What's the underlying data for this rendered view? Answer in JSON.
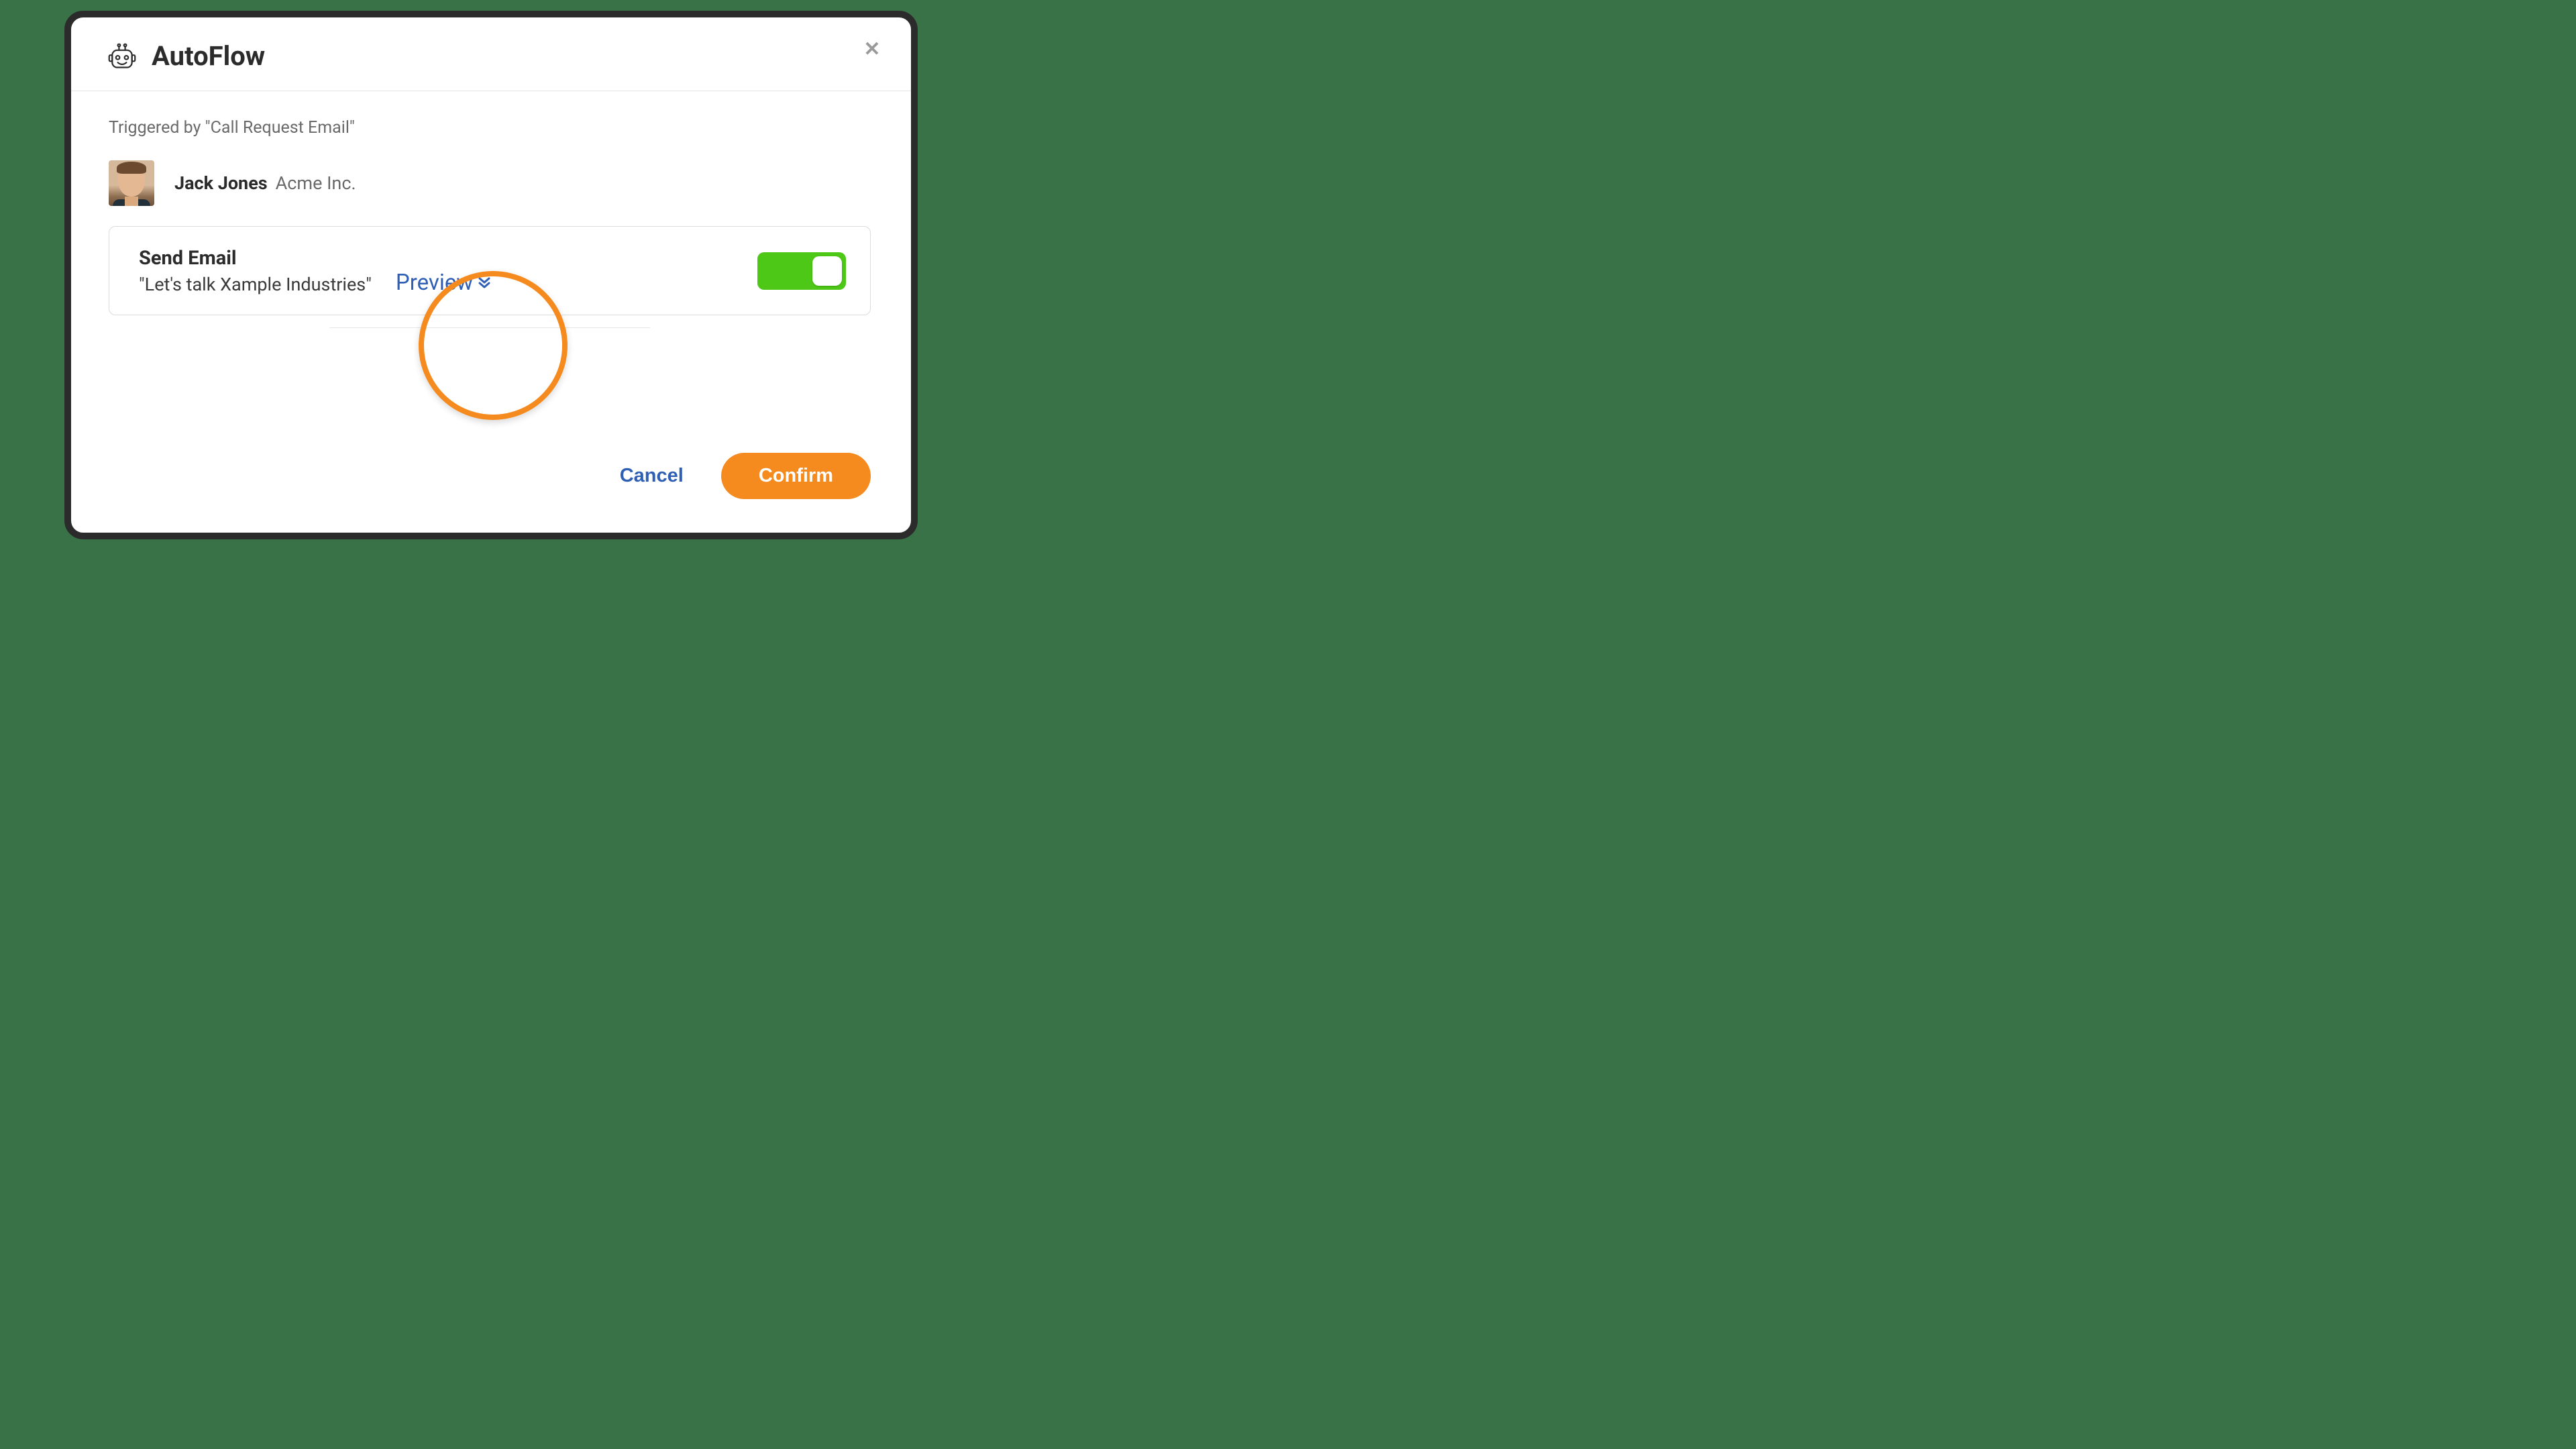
{
  "modal": {
    "title": "AutoFlow",
    "triggered_by": "Triggered by \"Call Request Email\"",
    "contact": {
      "name": "Jack Jones",
      "company": "Acme Inc."
    },
    "action": {
      "title": "Send Email",
      "subject": "\"Let's talk Xample Industries\"",
      "preview_label": "Preview",
      "enabled": true
    },
    "footer": {
      "cancel_label": "Cancel",
      "confirm_label": "Confirm"
    }
  },
  "colors": {
    "accent_orange": "#f58a1f",
    "link_blue": "#2f5fb5",
    "toggle_green": "#4ec817",
    "page_bg": "#3a7248"
  }
}
